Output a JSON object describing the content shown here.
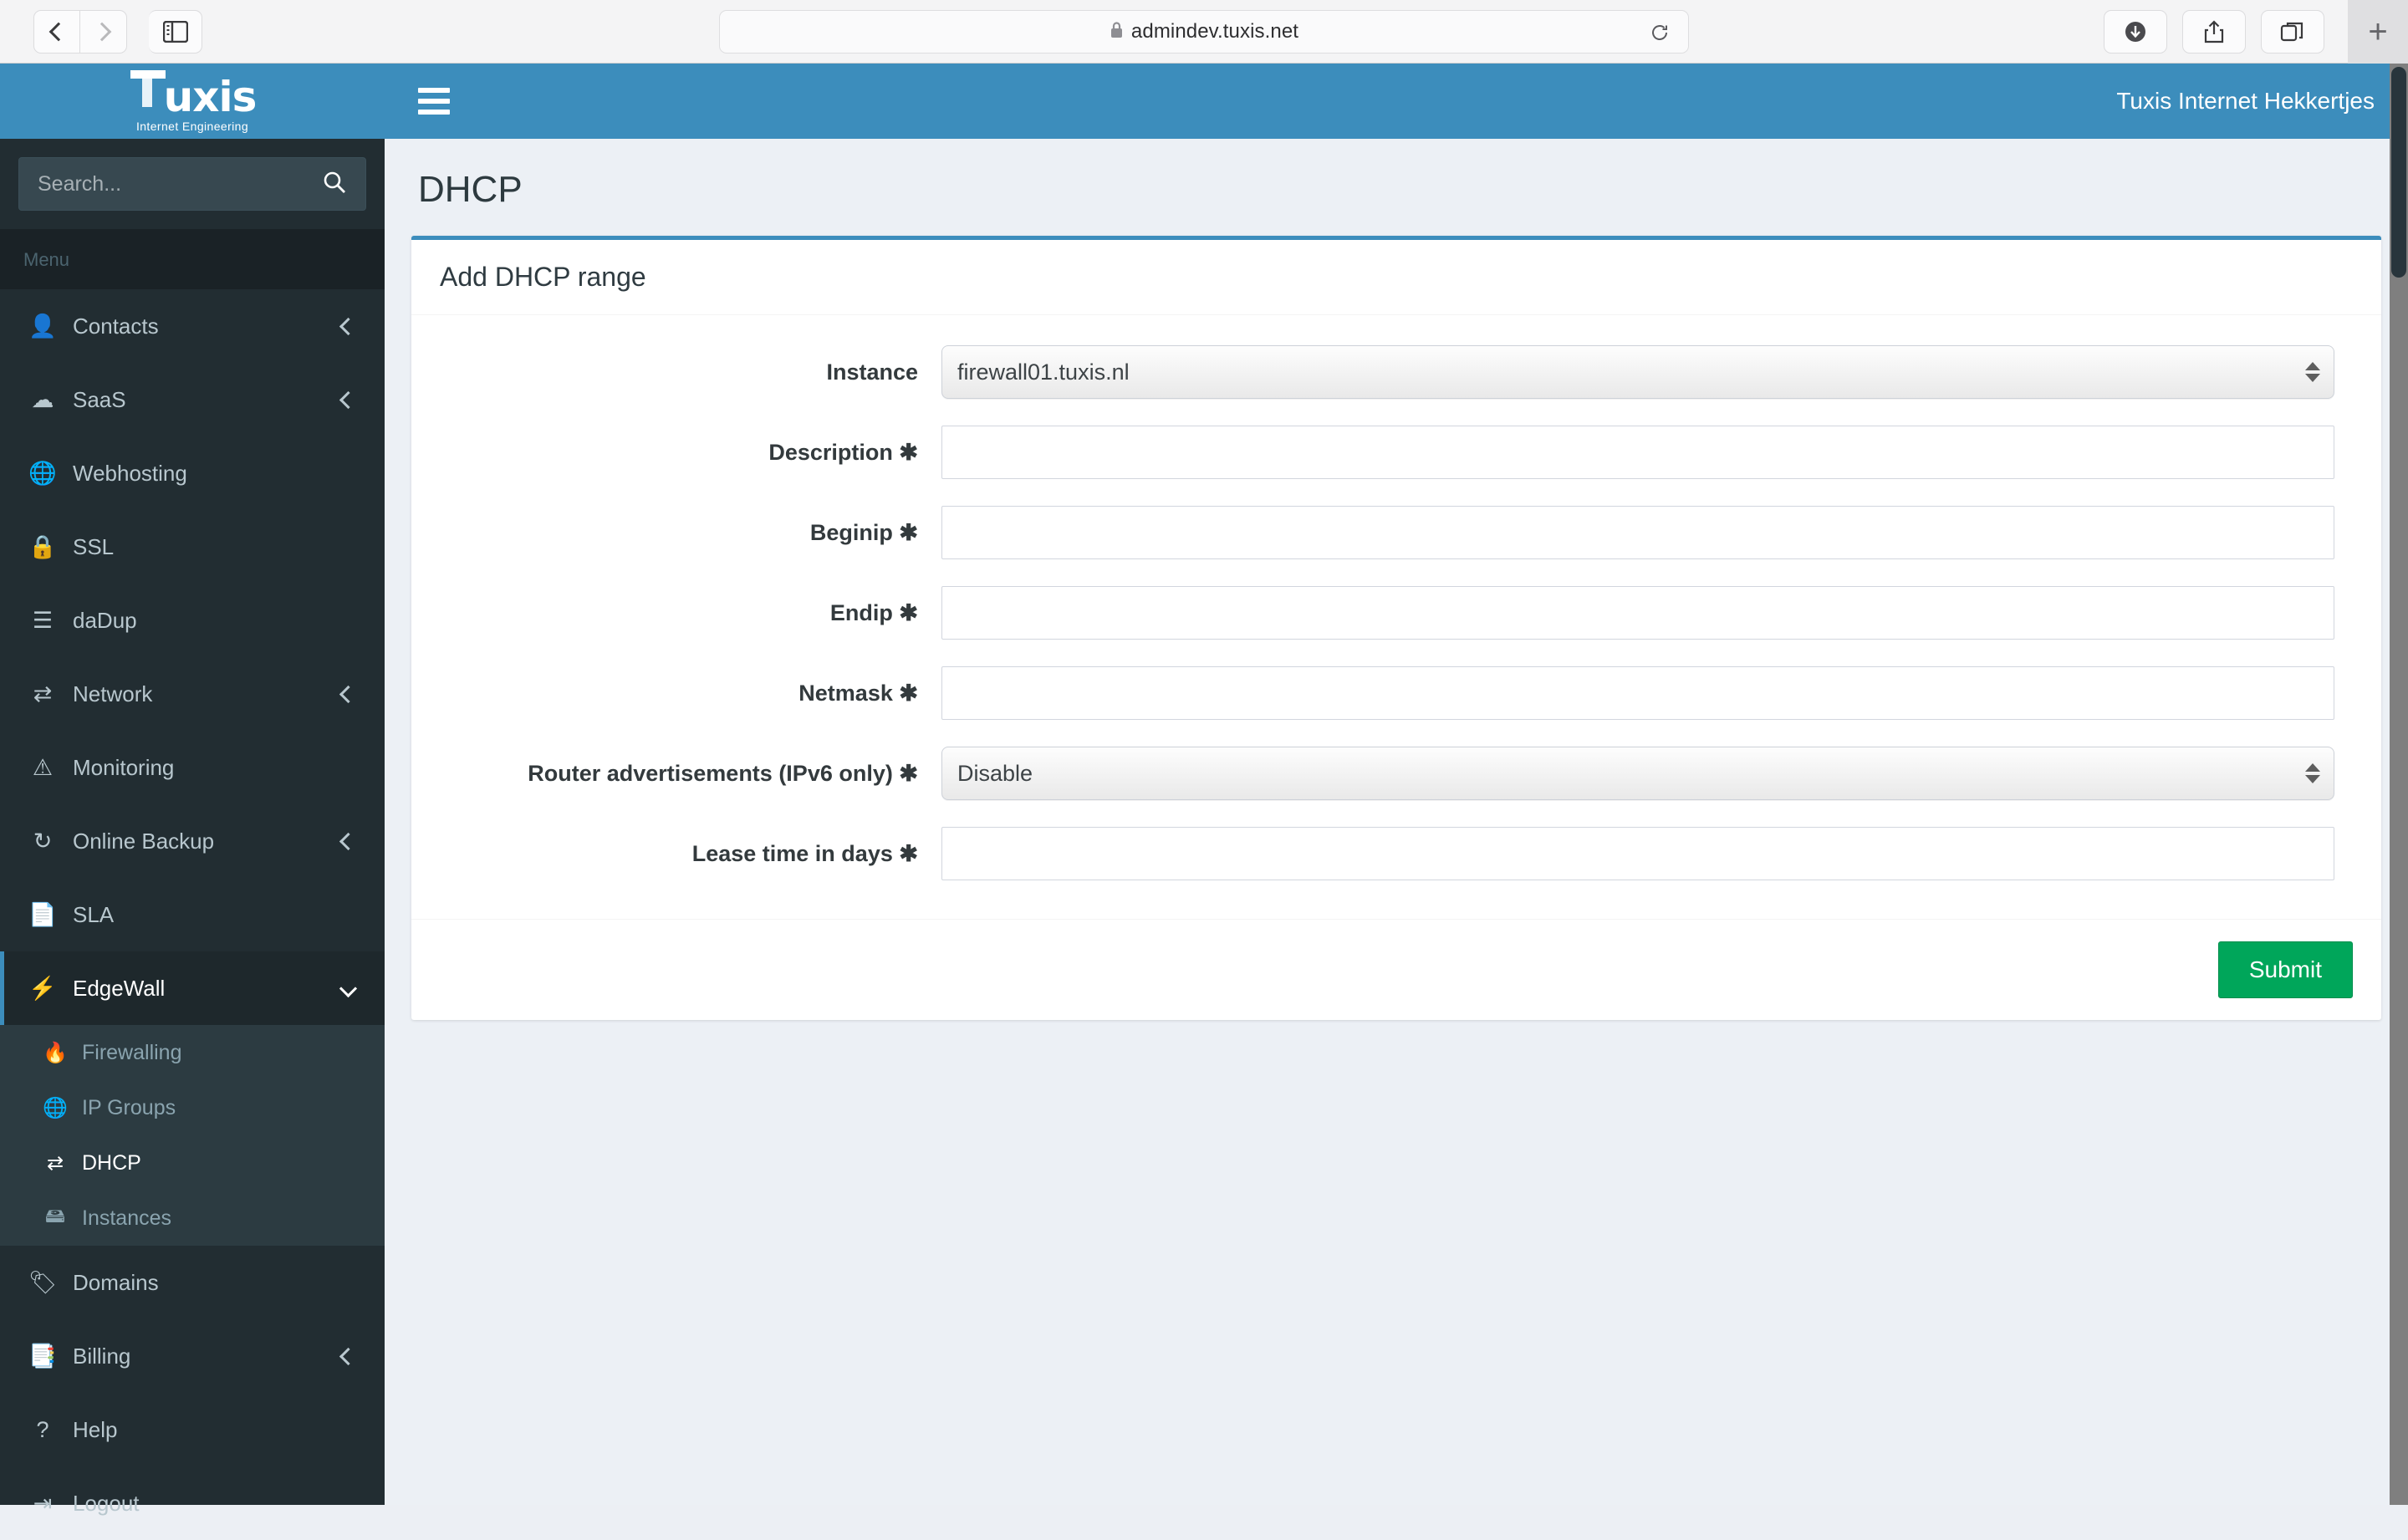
{
  "browser": {
    "url": "admindev.tuxis.net",
    "back_label": "Back",
    "forward_label": "Forward",
    "sidebar_toggle_label": "Show Sidebar",
    "reload_label": "Reload",
    "downloads_label": "Downloads",
    "share_label": "Share",
    "tabs_label": "Tab Overview",
    "new_tab_label": "+"
  },
  "brand": {
    "name": "Tuxis",
    "tagline": "Internet Engineering",
    "logo_t": "T",
    "logo_rest": "uxis"
  },
  "sidebar": {
    "search_placeholder": "Search...",
    "menu_header": "Menu",
    "items": [
      {
        "label": "Contacts",
        "icon": "user-icon",
        "glyph": "👤",
        "chevron": "right"
      },
      {
        "label": "SaaS",
        "icon": "cloud-icon",
        "glyph": "☁",
        "chevron": "right"
      },
      {
        "label": "Webhosting",
        "icon": "globe-icon",
        "glyph": "🌐",
        "chevron": "none"
      },
      {
        "label": "SSL",
        "icon": "lock-icon",
        "glyph": "🔒",
        "chevron": "none"
      },
      {
        "label": "daDup",
        "icon": "server-icon",
        "glyph": "☰",
        "chevron": "none"
      },
      {
        "label": "Network",
        "icon": "exchange-icon",
        "glyph": "⇄",
        "chevron": "right"
      },
      {
        "label": "Monitoring",
        "icon": "warning-icon",
        "glyph": "⚠",
        "chevron": "none"
      },
      {
        "label": "Online Backup",
        "icon": "refresh-icon",
        "glyph": "↻",
        "chevron": "right"
      },
      {
        "label": "SLA",
        "icon": "file-icon",
        "glyph": "📄",
        "chevron": "none"
      },
      {
        "label": "EdgeWall",
        "icon": "bolt-icon",
        "glyph": "⚡",
        "chevron": "down",
        "active": true
      },
      {
        "label": "Domains",
        "icon": "tag-icon",
        "glyph": "🏷",
        "chevron": "none"
      },
      {
        "label": "Billing",
        "icon": "invoice-icon",
        "glyph": "📑",
        "chevron": "right"
      },
      {
        "label": "Help",
        "icon": "question-icon",
        "glyph": "?",
        "chevron": "none"
      },
      {
        "label": "Logout",
        "icon": "signout-icon",
        "glyph": "⇥",
        "chevron": "none"
      }
    ],
    "submenu": [
      {
        "label": "Firewalling",
        "icon": "fire-icon",
        "glyph": "🔥",
        "active": false
      },
      {
        "label": "IP Groups",
        "icon": "globe-icon",
        "glyph": "🌐",
        "active": false
      },
      {
        "label": "DHCP",
        "icon": "exchange-icon",
        "glyph": "⇄",
        "active": true
      },
      {
        "label": "Instances",
        "icon": "server-icon",
        "glyph": "🖴",
        "active": false
      }
    ]
  },
  "topbar": {
    "menu_toggle_label": "Toggle navigation",
    "user": "Tuxis Internet Hekkertjes"
  },
  "main": {
    "page_title": "DHCP",
    "card_title": "Add DHCP range",
    "submit_label": "Submit",
    "required_mark": "✱",
    "fields": [
      {
        "label": "Instance",
        "required": false,
        "type": "select",
        "value": "firewall01.tuxis.nl",
        "name": "instance"
      },
      {
        "label": "Description",
        "required": true,
        "type": "text",
        "value": "",
        "name": "description"
      },
      {
        "label": "Beginip",
        "required": true,
        "type": "text",
        "value": "",
        "name": "beginip"
      },
      {
        "label": "Endip",
        "required": true,
        "type": "text",
        "value": "",
        "name": "endip"
      },
      {
        "label": "Netmask",
        "required": true,
        "type": "text",
        "value": "",
        "name": "netmask"
      },
      {
        "label": "Router advertisements (IPv6 only)",
        "required": true,
        "type": "select",
        "value": "Disable",
        "name": "router-advertisements"
      },
      {
        "label": "Lease time in days",
        "required": true,
        "type": "text",
        "value": "",
        "name": "lease-time"
      }
    ]
  },
  "colors": {
    "brand_blue": "#3c8dbc",
    "sidebar_dark": "#222d32",
    "submenu_bg": "#2c3b41",
    "content_bg": "#ecf0f5",
    "submit_green": "#00a65a"
  }
}
